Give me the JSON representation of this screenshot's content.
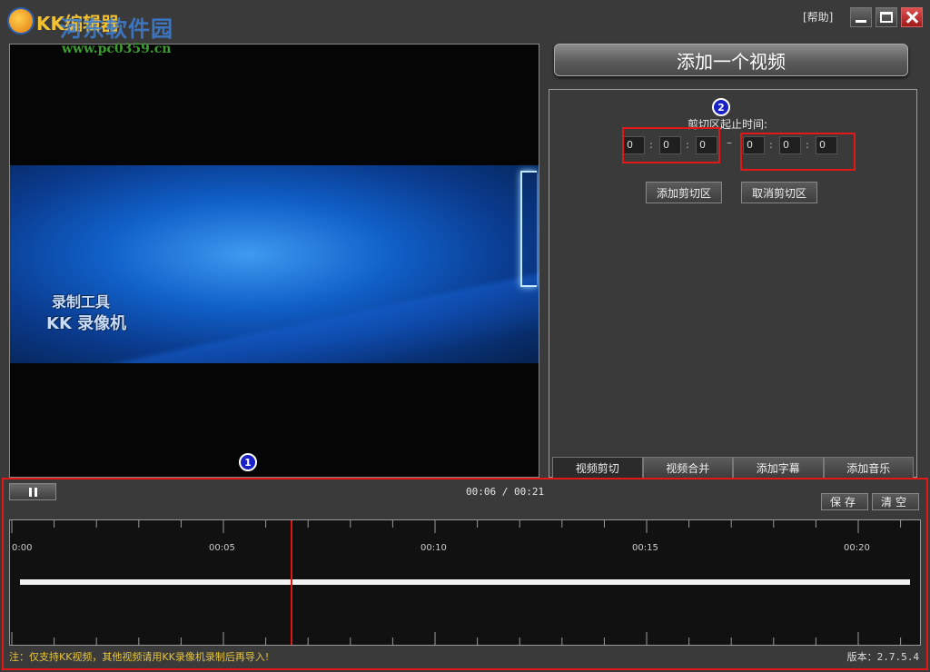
{
  "window": {
    "title": "KK编辑器",
    "watermark_title": "河东软件园",
    "watermark_url": "www.pc0359.cn",
    "help": "[帮助]"
  },
  "preview": {
    "line1": "录制工具",
    "line2": "KK 录像机"
  },
  "right_panel": {
    "add_video": "添加一个视频",
    "clip_range_label": "剪切区起止时间:",
    "start_time": [
      "0",
      "0",
      "0"
    ],
    "end_time": [
      "0",
      "0",
      "0"
    ],
    "time_separator": ":",
    "range_dash": "–",
    "add_clip": "添加剪切区",
    "cancel_clip": "取消剪切区",
    "tabs": [
      "视频剪切",
      "视频合并",
      "添加字幕",
      "添加音乐"
    ],
    "active_tab": "视频剪切"
  },
  "annotations": [
    "1",
    "2"
  ],
  "player": {
    "time_display": "00:06 / 00:21",
    "save": "保存",
    "clear": "清空",
    "playhead_seconds": 6.6,
    "duration_seconds": 21
  },
  "timeline": {
    "labels": [
      "0:00",
      "00:05",
      "00:10",
      "00:15",
      "00:20"
    ]
  },
  "footer": {
    "note": "注：仅支持KK视频，其他视频请用KK录像机录制后再导入!",
    "version_label": "版本：",
    "version": "2.7.5.4"
  },
  "colors": {
    "highlight": "#e01818",
    "badge": "#1a20c8",
    "note_text": "#e6c53a"
  }
}
